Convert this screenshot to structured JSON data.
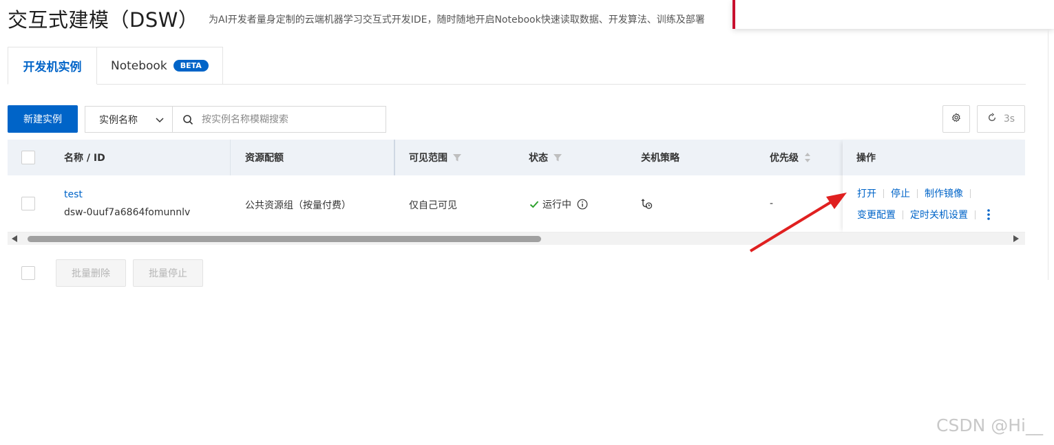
{
  "page": {
    "title": "交互式建模（DSW）",
    "subtitle": "为AI开发者量身定制的云端机器学习交互式开发IDE，随时随地开启Notebook快速读取数据、开发算法、训练及部署"
  },
  "tabs": [
    {
      "label": "开发机实例",
      "active": true
    },
    {
      "label": "Notebook",
      "badge": "BETA",
      "active": false
    }
  ],
  "toolbar": {
    "create_label": "新建实例",
    "filter_field_selected": "实例名称",
    "search_placeholder": "按实例名称模糊搜索",
    "refresh_label": "3s"
  },
  "table": {
    "columns": [
      "名称 / ID",
      "资源配额",
      "可见范围",
      "状态",
      "关机策略",
      "优先级",
      "操作"
    ],
    "rows": [
      {
        "name": "test",
        "id": "dsw-0uuf7a6864fomunnlv",
        "resource": "公共资源组（按量付费）",
        "visibility": "仅自己可见",
        "status": "运行中",
        "priority": "-",
        "actions_line1": [
          "打开",
          "停止",
          "制作镜像"
        ],
        "actions_line2": [
          "变更配置",
          "定时关机设置"
        ]
      }
    ]
  },
  "bulk": {
    "delete_label": "批量删除",
    "stop_label": "批量停止"
  },
  "watermark": "CSDN @Hi__",
  "colors": {
    "primary": "#0064c8",
    "success": "#2ca02c",
    "annotation_arrow": "#e02020"
  }
}
